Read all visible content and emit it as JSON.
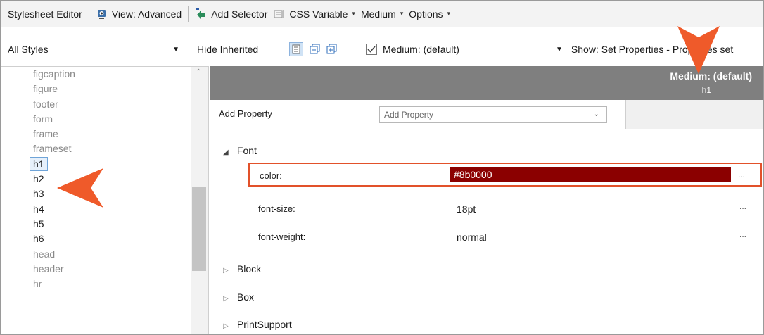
{
  "toolbar1": {
    "title": "Stylesheet Editor",
    "view_label": "View: Advanced",
    "add_selector_label": "Add Selector",
    "css_variable_label": "CSS Variable",
    "medium_label": "Medium",
    "options_label": "Options"
  },
  "toolbar2": {
    "filter_value": "All Styles",
    "hide_inherited_label": "Hide Inherited",
    "medium_checkbox_label": "Medium: (default)",
    "medium_checked": true,
    "show_label": "Show: Set Properties - Properties set"
  },
  "selectors": [
    {
      "label": "figcaption",
      "gray": true
    },
    {
      "label": "figure",
      "gray": true
    },
    {
      "label": "footer",
      "gray": true
    },
    {
      "label": "form",
      "gray": true
    },
    {
      "label": "frame",
      "gray": true
    },
    {
      "label": "frameset",
      "gray": true
    },
    {
      "label": "h1",
      "gray": false,
      "selected": true
    },
    {
      "label": "h2",
      "gray": false
    },
    {
      "label": "h3",
      "gray": false
    },
    {
      "label": "h4",
      "gray": false
    },
    {
      "label": "h5",
      "gray": false
    },
    {
      "label": "h6",
      "gray": false
    },
    {
      "label": "head",
      "gray": true
    },
    {
      "label": "header",
      "gray": true
    },
    {
      "label": "hr",
      "gray": true
    }
  ],
  "header": {
    "medium_title": "Medium: (default)",
    "selector_name": "h1"
  },
  "add_property": {
    "label": "Add Property",
    "placeholder": "Add Property"
  },
  "groups": {
    "font": {
      "label": "Font",
      "properties": {
        "color": {
          "name": "color:",
          "value": "#8b0000"
        },
        "font_size": {
          "name": "font-size:",
          "value": "18pt"
        },
        "font_weight": {
          "name": "font-weight:",
          "value": "normal"
        }
      }
    },
    "block": {
      "label": "Block"
    },
    "box": {
      "label": "Box"
    },
    "printsupport": {
      "label": "PrintSupport"
    }
  },
  "ellipsis": "...",
  "colors": {
    "header_bg": "#7f7f7f",
    "color_swatch": "#8b0000",
    "highlight": "#e2512a",
    "arrow": "#ef5a2a",
    "selection_border": "#6fa4d8"
  }
}
